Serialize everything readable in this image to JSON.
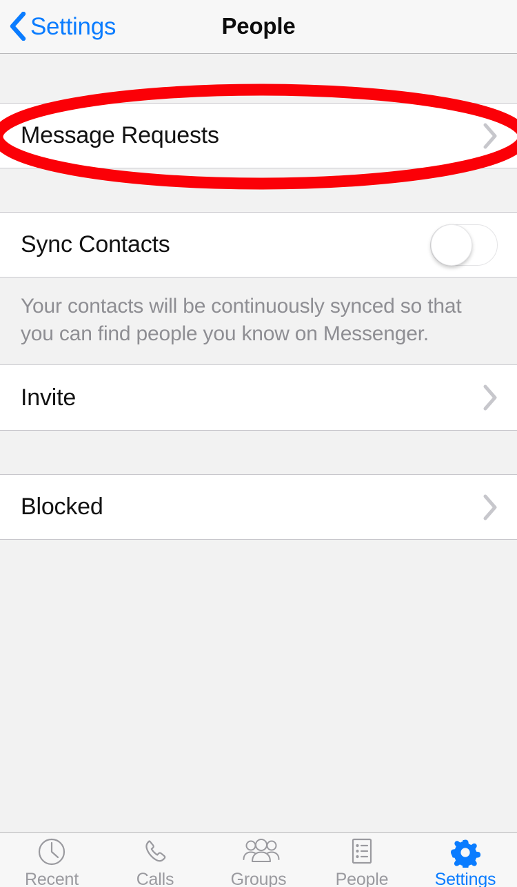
{
  "nav": {
    "back_label": "Settings",
    "back_icon": "chevron-left-icon",
    "title": "People"
  },
  "colors": {
    "accent_blue": "#0a7cff",
    "annotation_red": "#fb0007",
    "separator": "#c8c7cc",
    "group_background": "#f2f2f2",
    "cell_background": "#ffffff",
    "secondary_text": "#8e8e93",
    "chevron_gray": "#c7c7cc"
  },
  "sections": [
    {
      "rows": [
        {
          "label": "Message Requests",
          "accessory": "chevron-right-icon",
          "highlighted": true
        }
      ]
    },
    {
      "rows": [
        {
          "label": "Sync Contacts",
          "accessory": "toggle-switch",
          "toggle_state": "off"
        }
      ],
      "footer": "Your contacts will be continuously synced so that you can find people you know on Messenger."
    },
    {
      "rows": [
        {
          "label": "Invite",
          "accessory": "chevron-right-icon"
        }
      ]
    },
    {
      "rows": [
        {
          "label": "Blocked",
          "accessory": "chevron-right-icon"
        }
      ]
    }
  ],
  "tabbar": {
    "items": [
      {
        "label": "Recent",
        "icon": "clock-icon",
        "active": false
      },
      {
        "label": "Calls",
        "icon": "phone-icon",
        "active": false
      },
      {
        "label": "Groups",
        "icon": "people-group-icon",
        "active": false
      },
      {
        "label": "People",
        "icon": "list-icon",
        "active": false
      },
      {
        "label": "Settings",
        "icon": "gear-icon",
        "active": true
      }
    ]
  },
  "annotation": {
    "type": "ellipse-highlight",
    "target": "Message Requests",
    "color": "#fb0007"
  }
}
